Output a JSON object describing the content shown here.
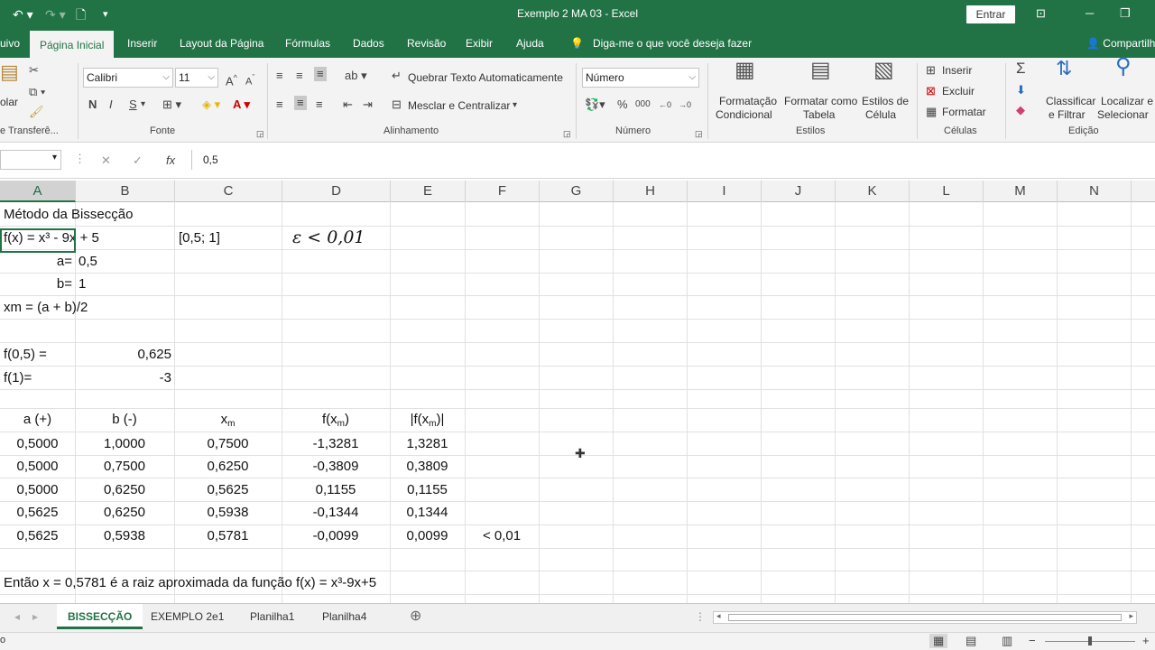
{
  "titlebar": {
    "title": "Exemplo 2 MA 03  -  Excel",
    "entrar": "Entrar"
  },
  "tabs": [
    "uivo",
    "Página Inicial",
    "Inserir",
    "Layout da Página",
    "Fórmulas",
    "Dados",
    "Revisão",
    "Exibir",
    "Ajuda"
  ],
  "tell_me": "Diga-me o que você deseja fazer",
  "share": "Compartilh",
  "ribbon": {
    "clipboard": {
      "paste": "olar",
      "label": "e Transferê..."
    },
    "font": {
      "name": "Calibri",
      "size": "11",
      "bold": "N",
      "italic": "I",
      "underline": "S",
      "label": "Fonte"
    },
    "align": {
      "wrap": "Quebrar Texto Automaticamente",
      "merge": "Mesclar e Centralizar",
      "label": "Alinhamento"
    },
    "number": {
      "format": "Número",
      "percent": "%",
      "thousands": "000",
      "label": "Número"
    },
    "styles": {
      "cond": "Formatação",
      "cond2": "Condicional",
      "table": "Formatar como",
      "table2": "Tabela",
      "cell": "Estilos de",
      "cell2": "Célula",
      "label": "Estilos"
    },
    "cells": {
      "insert": "Inserir",
      "delete": "Excluir",
      "format": "Formatar",
      "label": "Células"
    },
    "edit": {
      "sort": "Classificar",
      "sort2": "e Filtrar",
      "find": "Localizar e",
      "find2": "Selecionar",
      "label": "Edição"
    }
  },
  "formula_bar": {
    "value": "0,5"
  },
  "columns": [
    "A",
    "B",
    "C",
    "D",
    "E",
    "F",
    "G",
    "H",
    "I",
    "J",
    "K",
    "L",
    "M",
    "N"
  ],
  "cells": {
    "a1": "Método da Bissecção",
    "a2": "f(x) = x³ - 9x + 5",
    "c2": "[0,5; 1]",
    "d2": "ε < 0,01",
    "a3": "a=",
    "b3": "0,5",
    "a4": "b=",
    "b4": "1",
    "a5": "xm = (a + b)/2",
    "a7": "f(0,5) =",
    "b7": "0,625",
    "a8": "f(1)=",
    "b8": "-3",
    "h_a": "a (+)",
    "h_b": "b (-)",
    "h_c": "x",
    "h_c_sub": "m",
    "h_d": "f(x",
    "h_d_sub": "m",
    "h_d_end": ")",
    "h_e": "|f(x",
    "h_e_sub": "m",
    "h_e_end": ")|",
    "f15": "< 0,01",
    "conclusion": "Então x = 0,5781 é a raiz aproximada da função f(x) = x³-9x+5"
  },
  "table_rows": [
    [
      "0,5000",
      "1,0000",
      "0,7500",
      "-1,3281",
      "1,3281"
    ],
    [
      "0,5000",
      "0,7500",
      "0,6250",
      "-0,3809",
      "0,3809"
    ],
    [
      "0,5000",
      "0,6250",
      "0,5625",
      "0,1155",
      "0,1155"
    ],
    [
      "0,5625",
      "0,6250",
      "0,5938",
      "-0,1344",
      "0,1344"
    ],
    [
      "0,5625",
      "0,5938",
      "0,5781",
      "-0,0099",
      "0,0099"
    ]
  ],
  "sheets": [
    "BISSECÇÃO",
    "EXEMPLO 2e1",
    "Planilha1",
    "Planilha4"
  ],
  "status": {
    "left": "o"
  }
}
